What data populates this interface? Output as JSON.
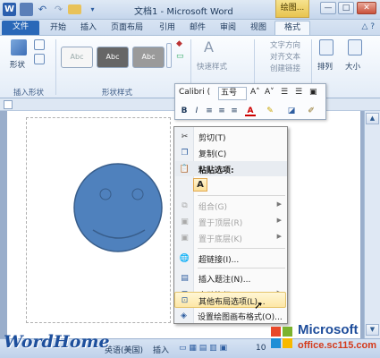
{
  "window": {
    "title": "文档1 - Microsoft Word",
    "context_group": "绘图...",
    "buttons": {
      "minimize": "—",
      "maximize": "□",
      "close": "✕"
    }
  },
  "tabs": {
    "file": "文件",
    "items": [
      "开始",
      "插入",
      "页面布局",
      "引用",
      "邮件",
      "审阅",
      "视图"
    ],
    "format": "格式",
    "help_icons": "△ ?"
  },
  "ribbon": {
    "shape_label": "形状",
    "insert_shapes_group": "插入形状",
    "shape_styles_group": "形状样式",
    "style_tiles": [
      "Abc",
      "Abc",
      "Abc"
    ],
    "quick_styles": "快速样式",
    "text_direction": "文字方向",
    "align_text": "对齐文本",
    "create_link": "创建链接",
    "arrange": "排列",
    "size": "大小"
  },
  "mini_toolbar": {
    "font": "Calibri (",
    "size": "五号",
    "bold": "B",
    "italic": "I"
  },
  "context_menu": {
    "items": [
      {
        "label": "剪切(T)",
        "icon": "scissors-icon",
        "disabled": false
      },
      {
        "label": "复制(C)",
        "icon": "copy-icon",
        "disabled": false
      },
      {
        "label": "粘贴选项:",
        "icon": "paste-icon",
        "disabled": false
      },
      {
        "label": "组合(G)",
        "icon": "group-icon",
        "disabled": true
      },
      {
        "label": "置于顶层(R)",
        "icon": "bring-front-icon",
        "disabled": true
      },
      {
        "label": "置于底层(K)",
        "icon": "send-back-icon",
        "disabled": true
      },
      {
        "label": "超链接(I)...",
        "icon": "hyperlink-icon",
        "disabled": false
      },
      {
        "label": "插入题注(N)...",
        "icon": "caption-icon",
        "disabled": false
      },
      {
        "label": "自动换行(W)",
        "icon": "wrap-icon",
        "disabled": false
      },
      {
        "label": "其他布局选项(L)...",
        "icon": "layout-icon",
        "disabled": false
      },
      {
        "label": "设置绘图画布格式(O)...",
        "icon": "format-canvas-icon",
        "disabled": false
      }
    ],
    "paste_option": "A"
  },
  "statusbar": {
    "language": "英语(美国)",
    "mode": "插入",
    "zoom": "10"
  },
  "watermark": {
    "left_logo": "WordHome",
    "brand": "Microsoft",
    "site": "office.sc115.com"
  },
  "colors": {
    "smiley_fill": "#4f81bd",
    "smiley_stroke": "#385d8a",
    "highlight": "#fde7a5",
    "file_tab": "#2a68b8"
  }
}
